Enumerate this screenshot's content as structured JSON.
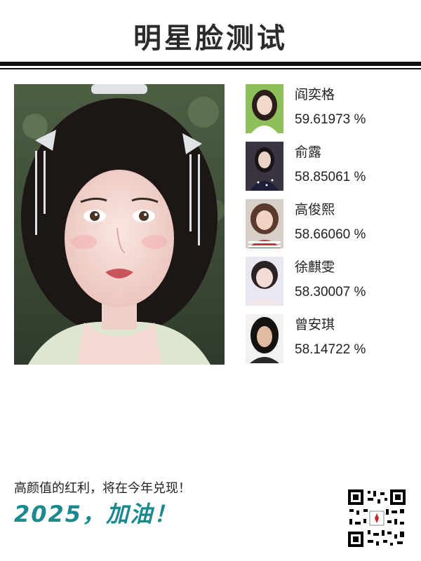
{
  "header": {
    "title": "明星脸测试"
  },
  "uploaded_photo": {
    "description_icon": "portrait-photo"
  },
  "matches": [
    {
      "name": "阎奕格",
      "score": "59.61973 %"
    },
    {
      "name": "俞露",
      "score": "58.85061 %"
    },
    {
      "name": "高俊熙",
      "score": "58.66060 %"
    },
    {
      "name": "徐麒雯",
      "score": "58.30007 %"
    },
    {
      "name": "曾安琪",
      "score": "58.14722 %"
    }
  ],
  "footer": {
    "slogan": "高颜值的红利，将在今年兑现！",
    "cheer": "2025，加油！",
    "cheer_color": "#1a8a8f"
  },
  "qr": {
    "icon": "qr-code-icon"
  }
}
